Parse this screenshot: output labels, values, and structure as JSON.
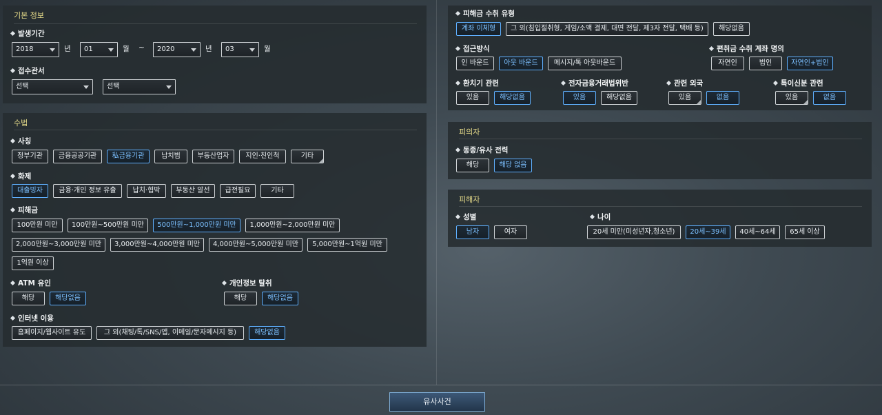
{
  "basic": {
    "title": "기본 정보",
    "period_label": "발생기간",
    "year_from": "2018",
    "month_from": "01",
    "year_to": "2020",
    "month_to": "03",
    "year_unit": "년",
    "month_unit": "월",
    "tilde": "~",
    "office_label": "접수관서",
    "office1": "선택",
    "office2": "선택"
  },
  "method": {
    "title": "수법",
    "impersonation": {
      "label": "사칭",
      "options": [
        "정부기관",
        "금융공공기관",
        "私금융기관",
        "납치범",
        "부동산업자",
        "지인·친인척",
        "기타"
      ]
    },
    "topic": {
      "label": "화제",
      "options": [
        "대출빙자",
        "금융·개인 정보 유출",
        "납치·협박",
        "부동산 알선",
        "급전필요",
        "기타"
      ]
    },
    "damage": {
      "label": "피해금",
      "options": [
        "100만원 미만",
        "100만원~500만원 미만",
        "500만원~1,000만원 미만",
        "1,000만원~2,000만원 미만",
        "2,000만원~3,000만원 미만",
        "3,000만원~4,000만원 미만",
        "4,000만원~5,000만원 미만",
        "5,000만원~1억원 미만",
        "1억원 이상"
      ]
    },
    "atm": {
      "label": "ATM 유인",
      "options": [
        "해당",
        "해당없음"
      ]
    },
    "privacy": {
      "label": "개인정보 탈취",
      "options": [
        "해당",
        "해당없음"
      ]
    },
    "internet": {
      "label": "인터넷 이용",
      "options": [
        "홈페이지/웹사이트 유도",
        "그 외(채팅/톡/SNS/앱, 이메일/문자메시지 등)",
        "해당없음"
      ]
    }
  },
  "right": {
    "receipt_type": {
      "label": "피해금 수취 유형",
      "options": [
        "계좌 이체형",
        "그 외(침입절취형, 게임/소액 결제, 대면 전달, 제3자 전달, 택배 등)",
        "해당없음"
      ]
    },
    "access": {
      "label": "접근방식",
      "options": [
        "인 바운드",
        "아웃 바운드",
        "메시지/톡 아웃바운드"
      ]
    },
    "account_owner": {
      "label": "편취금 수취 계좌 명의",
      "options": [
        "자연인",
        "법인",
        "자연인+법인"
      ]
    },
    "exchange": {
      "label": "환치기 관련",
      "options": [
        "있음",
        "해당없음"
      ]
    },
    "efta": {
      "label": "전자금융거래법위반",
      "options": [
        "있음",
        "해당없음"
      ]
    },
    "overseas": {
      "label": "관련 외국",
      "options": [
        "있음",
        "없음"
      ]
    },
    "special": {
      "label": "특이신분 관련",
      "options": [
        "있음",
        "없음"
      ]
    }
  },
  "suspect": {
    "title": "피의자",
    "history": {
      "label": "동종/유사 전력",
      "options": [
        "해당",
        "해당 없음"
      ]
    }
  },
  "victim": {
    "title": "피해자",
    "gender": {
      "label": "성별",
      "options": [
        "남자",
        "여자"
      ]
    },
    "age": {
      "label": "나이",
      "options": [
        "20세 미만(미성년자,청소년)",
        "20세~39세",
        "40세~64세",
        "65세 이상"
      ]
    }
  },
  "search_button": "유사사건",
  "colors": {
    "accent": "#5fb0ff",
    "title": "#e7dc8a",
    "panel": "#262c30"
  }
}
